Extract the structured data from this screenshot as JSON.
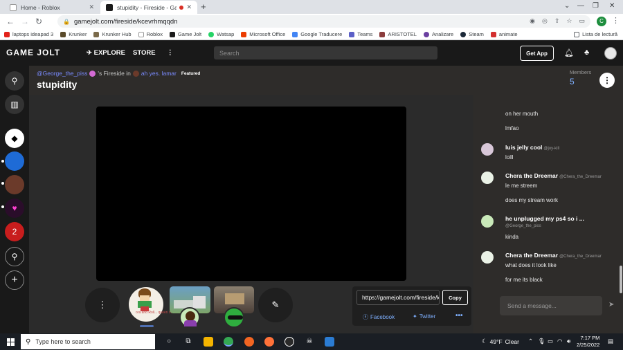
{
  "browser": {
    "tabs": [
      {
        "title": "Home - Roblox",
        "close": "✕"
      },
      {
        "title": "stupidity - Fireside - Game Jolt",
        "close": "✕"
      }
    ],
    "new_tab": "+",
    "window_controls": {
      "minimize": "—",
      "maximize": "❐",
      "close": "✕"
    },
    "url": "gamejolt.com/fireside/kcevrhmqqdn",
    "profile_initial": "C",
    "bookmarks": [
      "laptops ideapad 3",
      "Krunker",
      "Krunker Hub",
      "Roblox",
      "Game Jolt",
      "Watsap",
      "Microsoft Office",
      "Google Traducere",
      "Teams",
      "ARISTOTEL",
      "Analizare",
      "Steam",
      "animate"
    ],
    "reading_list": "Lista de lectură"
  },
  "gamejolt": {
    "logo": "GAME JOLT",
    "nav": {
      "explore": "EXPLORE",
      "store": "STORE",
      "more": "⋮"
    },
    "search_placeholder": "Search",
    "get_app": "Get App",
    "icons": {
      "bell": "bell-icon",
      "quests": "quest-icon"
    }
  },
  "fireside": {
    "owner": "@George_the_piss",
    "connector": "'s Fireside in",
    "community": "ah yes. lamar",
    "featured": "Featured",
    "title": "stupidity",
    "members_label": "Members",
    "members_count": "5",
    "menu": "⋮"
  },
  "stage": {
    "options": "⋮",
    "sticker": "✎",
    "streamer1_caption": "ora and Roll... queen of"
  },
  "share": {
    "url": "https://gamejolt.com/fireside/kcevrhmqqdn",
    "copy": "Copy",
    "facebook": "Facebook",
    "twitter": "Twitter",
    "more": "•••"
  },
  "chat": {
    "lines": [
      {
        "text": "on her mouth"
      },
      {
        "text": "lmfao"
      }
    ],
    "messages": [
      {
        "user": "luis jelly cool",
        "handle": "@joy-kill",
        "lines": [
          "lolll"
        ]
      },
      {
        "user": "Chera the Dreemar",
        "handle": "@Chera_the_Dreemar",
        "lines": [
          "le me streem",
          "does my stream work"
        ]
      },
      {
        "user": "he unplugged my ps4 so i ...",
        "handle": "@George_the_piss",
        "lines": [
          "kinda"
        ]
      },
      {
        "user": "Chera the Dreemar",
        "handle": "@Chera_the_Dreemar",
        "lines": [
          "what does it look like",
          "for me its black"
        ]
      }
    ],
    "input_placeholder": "Send a message...",
    "send": "➤"
  },
  "taskbar": {
    "search_placeholder": "Type here to search",
    "weather_temp": "49°F",
    "weather_desc": "Clear",
    "time": "7:17 PM",
    "date": "2/25/2022"
  }
}
